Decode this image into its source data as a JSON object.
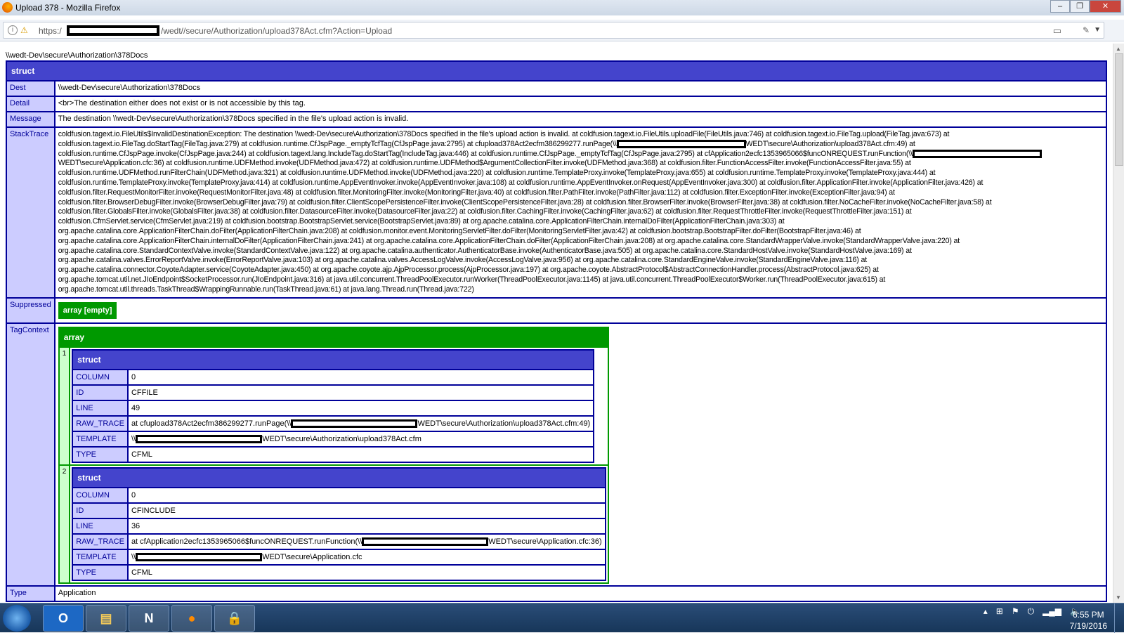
{
  "window": {
    "title": "Upload 378 - Mozilla Firefox",
    "minimize": "‒",
    "restore": "❐",
    "close": "✕"
  },
  "navbar": {
    "scheme": "https:/",
    "url_path": "/wedt//secure/Authorization/upload378Act.cfm?Action=Upload"
  },
  "page": {
    "path_line": "\\\\wedt-Dev\\secure\\Authorization\\378Docs",
    "dump": {
      "header": "struct",
      "rows": {
        "dest": {
          "label": "Dest",
          "value": "\\\\wedt-Dev\\secure\\Authorization\\378Docs"
        },
        "detail": {
          "label": "Detail",
          "value": "<br>The destination either does not exist or is not accessible by this tag."
        },
        "message": {
          "label": "Message",
          "value": "The destination \\\\wedt-Dev\\secure\\Authorization\\378Docs specified in the file's upload action is invalid."
        },
        "stacktrace": {
          "label": "StackTrace",
          "lines": [
            [
              "coldfusion.tagext.io.FileUtils$InvalidDestinationException: The destination \\\\wedt-Dev\\secure\\Authorization\\378Docs specified in the file's upload action is invalid. at coldfusion.tagext.io.FileUtils.uploadFile(FileUtils.java:746) at coldfusion.tagext.io.FileTag.upload(FileTag.java:673) at"
            ],
            [
              "coldfusion.tagext.io.FileTag.doStartTag(FileTag.java:279) at coldfusion.runtime.CfJspPage._emptyTcfTag(CfJspPage.java:2795) at cfupload378Act2ecfm386299277.runPage(\\\\",
              null,
              "WEDT\\secure\\Authorization\\upload378Act.cfm:49) at"
            ],
            [
              "coldfusion.runtime.CfJspPage.invoke(CfJspPage.java:244) at coldfusion.tagext.lang.IncludeTag.doStartTag(IncludeTag.java:446) at coldfusion.runtime.CfJspPage._emptyTcfTag(CfJspPage.java:2795) at cfApplication2ecfc1353965066$funcONREQUEST.runFunction(\\\\",
              null
            ],
            [
              "WEDT\\secure\\Application.cfc:36) at coldfusion.runtime.UDFMethod.invoke(UDFMethod.java:472) at coldfusion.runtime.UDFMethod$ArgumentCollectionFilter.invoke(UDFMethod.java:368) at coldfusion.filter.FunctionAccessFilter.invoke(FunctionAccessFilter.java:55) at"
            ],
            [
              "coldfusion.runtime.UDFMethod.runFilterChain(UDFMethod.java:321) at coldfusion.runtime.UDFMethod.invoke(UDFMethod.java:220) at coldfusion.runtime.TemplateProxy.invoke(TemplateProxy.java:655) at coldfusion.runtime.TemplateProxy.invoke(TemplateProxy.java:444) at"
            ],
            [
              "coldfusion.runtime.TemplateProxy.invoke(TemplateProxy.java:414) at coldfusion.runtime.AppEventInvoker.invoke(AppEventInvoker.java:108) at coldfusion.runtime.AppEventInvoker.onRequest(AppEventInvoker.java:300) at coldfusion.filter.ApplicationFilter.invoke(ApplicationFilter.java:426) at"
            ],
            [
              "coldfusion.filter.RequestMonitorFilter.invoke(RequestMonitorFilter.java:48) at coldfusion.filter.MonitoringFilter.invoke(MonitoringFilter.java:40) at coldfusion.filter.PathFilter.invoke(PathFilter.java:112) at coldfusion.filter.ExceptionFilter.invoke(ExceptionFilter.java:94) at"
            ],
            [
              "coldfusion.filter.BrowserDebugFilter.invoke(BrowserDebugFilter.java:79) at coldfusion.filter.ClientScopePersistenceFilter.invoke(ClientScopePersistenceFilter.java:28) at coldfusion.filter.BrowserFilter.invoke(BrowserFilter.java:38) at coldfusion.filter.NoCacheFilter.invoke(NoCacheFilter.java:58) at"
            ],
            [
              "coldfusion.filter.GlobalsFilter.invoke(GlobalsFilter.java:38) at coldfusion.filter.DatasourceFilter.invoke(DatasourceFilter.java:22) at coldfusion.filter.CachingFilter.invoke(CachingFilter.java:62) at coldfusion.filter.RequestThrottleFilter.invoke(RequestThrottleFilter.java:151) at"
            ],
            [
              "coldfusion.CfmServlet.service(CfmServlet.java:219) at coldfusion.bootstrap.BootstrapServlet.service(BootstrapServlet.java:89) at org.apache.catalina.core.ApplicationFilterChain.internalDoFilter(ApplicationFilterChain.java:303) at"
            ],
            [
              "org.apache.catalina.core.ApplicationFilterChain.doFilter(ApplicationFilterChain.java:208) at coldfusion.monitor.event.MonitoringServletFilter.doFilter(MonitoringServletFilter.java:42) at coldfusion.bootstrap.BootstrapFilter.doFilter(BootstrapFilter.java:46) at"
            ],
            [
              "org.apache.catalina.core.ApplicationFilterChain.internalDoFilter(ApplicationFilterChain.java:241) at org.apache.catalina.core.ApplicationFilterChain.doFilter(ApplicationFilterChain.java:208) at org.apache.catalina.core.StandardWrapperValve.invoke(StandardWrapperValve.java:220) at"
            ],
            [
              "org.apache.catalina.core.StandardContextValve.invoke(StandardContextValve.java:122) at org.apache.catalina.authenticator.AuthenticatorBase.invoke(AuthenticatorBase.java:505) at org.apache.catalina.core.StandardHostValve.invoke(StandardHostValve.java:169) at"
            ],
            [
              "org.apache.catalina.valves.ErrorReportValve.invoke(ErrorReportValve.java:103) at org.apache.catalina.valves.AccessLogValve.invoke(AccessLogValve.java:956) at org.apache.catalina.core.StandardEngineValve.invoke(StandardEngineValve.java:116) at"
            ],
            [
              "org.apache.catalina.connector.CoyoteAdapter.service(CoyoteAdapter.java:450) at org.apache.coyote.ajp.AjpProcessor.process(AjpProcessor.java:197) at org.apache.coyote.AbstractProtocol$AbstractConnectionHandler.process(AbstractProtocol.java:625) at"
            ],
            [
              "org.apache.tomcat.util.net.JIoEndpoint$SocketProcessor.run(JIoEndpoint.java:316) at java.util.concurrent.ThreadPoolExecutor.runWorker(ThreadPoolExecutor.java:1145) at java.util.concurrent.ThreadPoolExecutor$Worker.run(ThreadPoolExecutor.java:615) at"
            ],
            [
              "org.apache.tomcat.util.threads.TaskThread$WrappingRunnable.run(TaskThread.java:61) at java.lang.Thread.run(Thread.java:722)"
            ]
          ]
        },
        "suppressed": {
          "label": "Suppressed",
          "value": "array [empty]"
        },
        "tagcontext": {
          "label": "TagContext",
          "array_header": "array",
          "items": [
            {
              "index": "1",
              "header": "struct",
              "fields": [
                {
                  "key": "COLUMN",
                  "value": [
                    "0"
                  ]
                },
                {
                  "key": "ID",
                  "value": [
                    "CFFILE"
                  ]
                },
                {
                  "key": "LINE",
                  "value": [
                    "49"
                  ]
                },
                {
                  "key": "RAW_TRACE",
                  "value": [
                    "at cfupload378Act2ecfm386299277.runPage(\\\\",
                    null,
                    "WEDT\\secure\\Authorization\\upload378Act.cfm:49)"
                  ]
                },
                {
                  "key": "TEMPLATE",
                  "value": [
                    "\\\\",
                    null,
                    "WEDT\\secure\\Authorization\\upload378Act.cfm"
                  ]
                },
                {
                  "key": "TYPE",
                  "value": [
                    "CFML"
                  ]
                }
              ]
            },
            {
              "index": "2",
              "header": "struct",
              "fields": [
                {
                  "key": "COLUMN",
                  "value": [
                    "0"
                  ]
                },
                {
                  "key": "ID",
                  "value": [
                    "CFINCLUDE"
                  ]
                },
                {
                  "key": "LINE",
                  "value": [
                    "36"
                  ]
                },
                {
                  "key": "RAW_TRACE",
                  "value": [
                    "at cfApplication2ecfc1353965066$funcONREQUEST.runFunction(\\\\",
                    null,
                    "WEDT\\secure\\Application.cfc:36)"
                  ]
                },
                {
                  "key": "TEMPLATE",
                  "value": [
                    "\\\\",
                    null,
                    "WEDT\\secure\\Application.cfc"
                  ]
                },
                {
                  "key": "TYPE",
                  "value": [
                    "CFML"
                  ]
                }
              ]
            }
          ]
        },
        "type": {
          "label": "Type",
          "value": "Application"
        }
      }
    }
  },
  "taskbar": {
    "apps": [
      "outlook-icon",
      "file-explorer-icon",
      "app-icon",
      "firefox-icon",
      "lock-app-icon"
    ],
    "time": "6:55 PM",
    "date": "7/19/2016"
  },
  "colors": {
    "struct_header": "#4444cc",
    "struct_label_bg": "#ccccff",
    "array_header": "#009900",
    "array_label_bg": "#ccffcc"
  }
}
